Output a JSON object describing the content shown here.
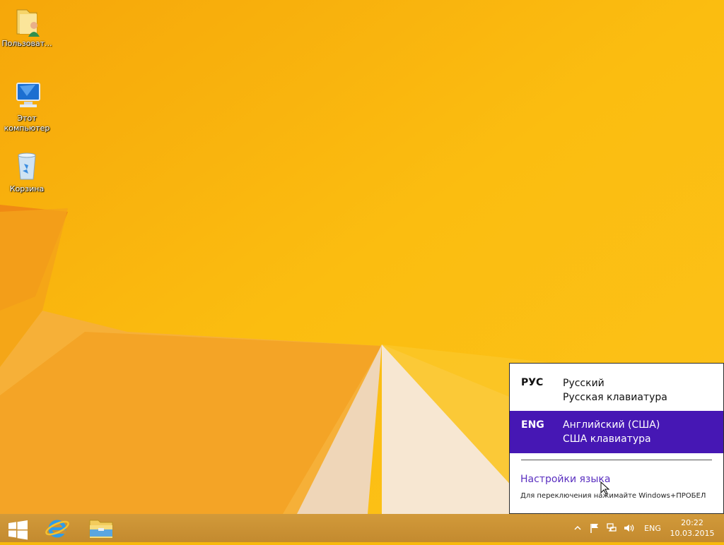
{
  "desktop": {
    "icons": [
      {
        "label": "Пользоват...",
        "icon": "user-folder-icon"
      },
      {
        "label": "Этот компьютер",
        "icon": "computer-icon"
      },
      {
        "label": "Корзина",
        "icon": "recycle-bin-icon"
      }
    ]
  },
  "taskbar": {
    "pinned": [
      {
        "name": "start",
        "icon": "windows-logo-icon"
      },
      {
        "name": "internet-explorer",
        "icon": "internet-explorer-icon"
      },
      {
        "name": "file-explorer",
        "icon": "file-explorer-icon"
      }
    ],
    "tray": {
      "lang": "ENG",
      "time": "20:22",
      "date": "10.03.2015"
    }
  },
  "lang_flyout": {
    "items": [
      {
        "code": "РУС",
        "name": "Русский",
        "keyboard": "Русская клавиатура",
        "selected": false
      },
      {
        "code": "ENG",
        "name": "Английский (США)",
        "keyboard": "США клавиатура",
        "selected": true
      }
    ],
    "settings_link": "Настройки языка",
    "hint": "Для переключения нажимайте Windows+ПРОБЕЛ"
  },
  "colors": {
    "accent": "#4617b4",
    "wallpaper": "#f8b90c",
    "link": "#5a2fc0"
  }
}
